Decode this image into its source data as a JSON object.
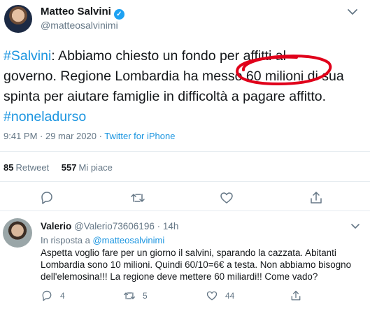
{
  "tweet": {
    "author_name": "Matteo Salvini",
    "author_handle": "@matteosalvinimi",
    "text_lines": [
      {
        "hashtag": "#Salvini",
        "rest": ": Abbiamo chiesto un fondo per affitti al"
      },
      {
        "text": "governo. Regione Lombardia ha messo 60 milioni di sua"
      },
      {
        "text": "spinta per aiutare famiglie in difficoltà a pagare affitto."
      },
      {
        "hashtag": "#noneladurso"
      }
    ],
    "time": "9:41 PM · 29 mar 2020 · ",
    "source": "Twitter for iPhone",
    "retweets_count": "85",
    "retweets_label": "Retweet",
    "likes_count": "557",
    "likes_label": "Mi piace",
    "annotation_color": "#e0001a"
  },
  "reply": {
    "author_name": "Valerio",
    "author_handle": "@Valerio73606196 · 14h",
    "in_reply_prefix": "In risposta a ",
    "in_reply_mention": "@matteosalvinimi",
    "text_lines": [
      "Aspetta voglio fare per un giorno il salvini, sparando la cazzata. Abitanti",
      "Lombardia sono 10 milioni. Quindi 60/10=6€ a testa. Non abbiamo bisogno",
      "dell'elemosina!!! La regione deve mettere 60 miliardi!! Come vado?"
    ],
    "replies": "4",
    "retweets": "5",
    "likes": "44"
  },
  "icons": {
    "verified": "verified-badge-icon",
    "caret": "chevron-down-icon",
    "reply": "reply-icon",
    "retweet": "retweet-icon",
    "like": "heart-icon",
    "share": "share-icon"
  },
  "colors": {
    "link": "#1b95e0",
    "muted": "#657786",
    "verified": "#1da1f2"
  }
}
